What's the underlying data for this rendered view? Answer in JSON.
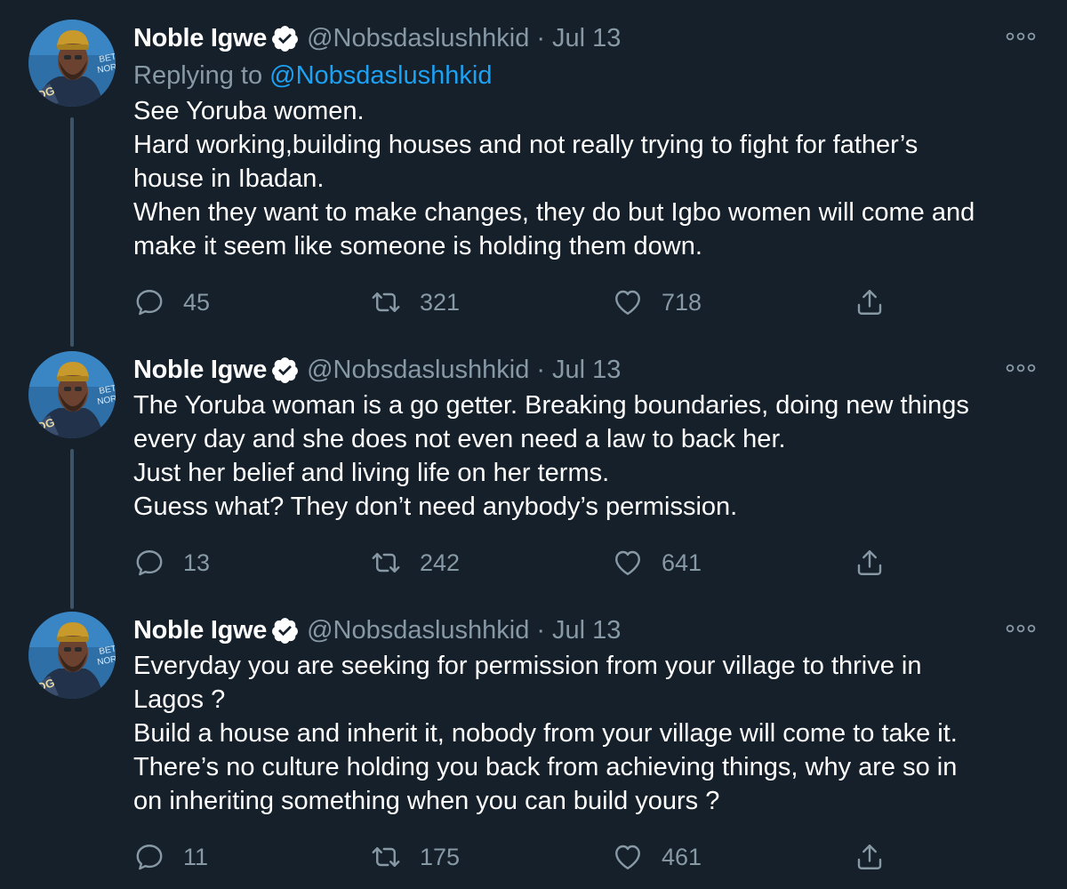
{
  "tweets": [
    {
      "author": "Noble Igwe",
      "handle": "@Nobsdaslushhkid",
      "dot": "·",
      "date": "Jul 13",
      "replying_prefix": "Replying to ",
      "replying_handle": "@Nobsdaslushhkid",
      "lines": [
        "See Yoruba women.",
        "Hard working,building houses and not really trying to fight for father’s",
        "house in Ibadan.",
        "When they want to make changes, they do but Igbo women will come and",
        "make it seem like someone is holding them down."
      ],
      "replies": "45",
      "retweets": "321",
      "likes": "718"
    },
    {
      "author": "Noble Igwe",
      "handle": "@Nobsdaslushhkid",
      "dot": "·",
      "date": "Jul 13",
      "lines": [
        "The Yoruba woman is a go getter. Breaking boundaries, doing new things",
        "every day and she does not even need a law to back her.",
        "Just her belief and living life on her terms.",
        "Guess what? They don’t need anybody’s permission."
      ],
      "replies": "13",
      "retweets": "242",
      "likes": "641"
    },
    {
      "author": "Noble Igwe",
      "handle": "@Nobsdaslushhkid",
      "dot": "·",
      "date": "Jul 13",
      "lines": [
        "Everyday you are seeking for permission from your village to thrive in",
        "Lagos ?",
        "Build a house and inherit it, nobody from your village will come to take it.",
        "There’s no culture holding you back from achieving things, why are so in",
        "on inheriting something when you can build yours ?"
      ],
      "replies": "11",
      "retweets": "175",
      "likes": "461"
    }
  ],
  "colors": {
    "background": "#15202b",
    "text": "#ffffff",
    "secondary": "#8899a6",
    "link": "#1da1f2",
    "thread_line": "#3d5466"
  },
  "icons": {
    "reply": "reply-icon",
    "retweet": "retweet-icon",
    "like": "like-icon",
    "share": "share-icon",
    "more": "more-icon",
    "verified": "verified-badge-icon"
  }
}
